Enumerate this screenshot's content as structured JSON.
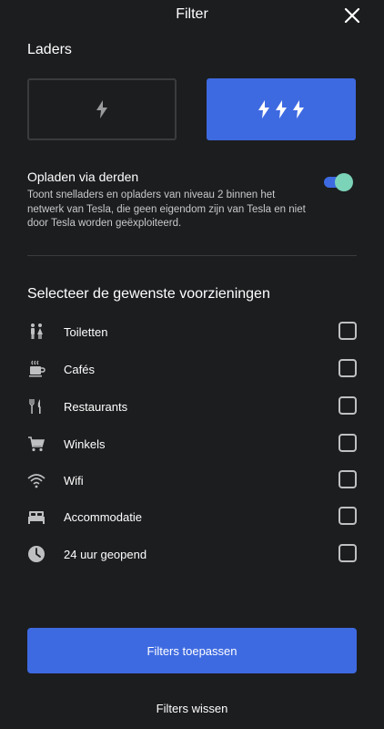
{
  "header": {
    "title": "Filter",
    "close_icon": "close-icon"
  },
  "chargers": {
    "title": "Laders",
    "options": [
      {
        "icon": "single-bolt-icon",
        "selected": false
      },
      {
        "icon": "triple-bolt-icon",
        "selected": true
      }
    ]
  },
  "third_party": {
    "label": "Opladen via derden",
    "description": "Toont snelladers en opladers van niveau 2 binnen het netwerk van Tesla, die geen eigendom zijn van Tesla en niet door Tesla worden geëxploiteerd.",
    "enabled": true
  },
  "amenities": {
    "title": "Selecteer de gewenste voorzieningen",
    "items": [
      {
        "label": "Toiletten",
        "icon": "restroom-icon",
        "checked": false
      },
      {
        "label": "Cafés",
        "icon": "coffee-cup-icon",
        "checked": false
      },
      {
        "label": "Restaurants",
        "icon": "fork-knife-icon",
        "checked": false
      },
      {
        "label": "Winkels",
        "icon": "shopping-cart-icon",
        "checked": false
      },
      {
        "label": "Wifi",
        "icon": "wifi-icon",
        "checked": false
      },
      {
        "label": "Accommodatie",
        "icon": "bed-icon",
        "checked": false
      },
      {
        "label": "24 uur geopend",
        "icon": "clock-icon",
        "checked": false
      }
    ]
  },
  "actions": {
    "apply_label": "Filters toepassen",
    "clear_label": "Filters wissen"
  },
  "colors": {
    "background": "#1c1d1f",
    "accent": "#3e6ae1",
    "toggle_knob": "#7bd3b8"
  }
}
